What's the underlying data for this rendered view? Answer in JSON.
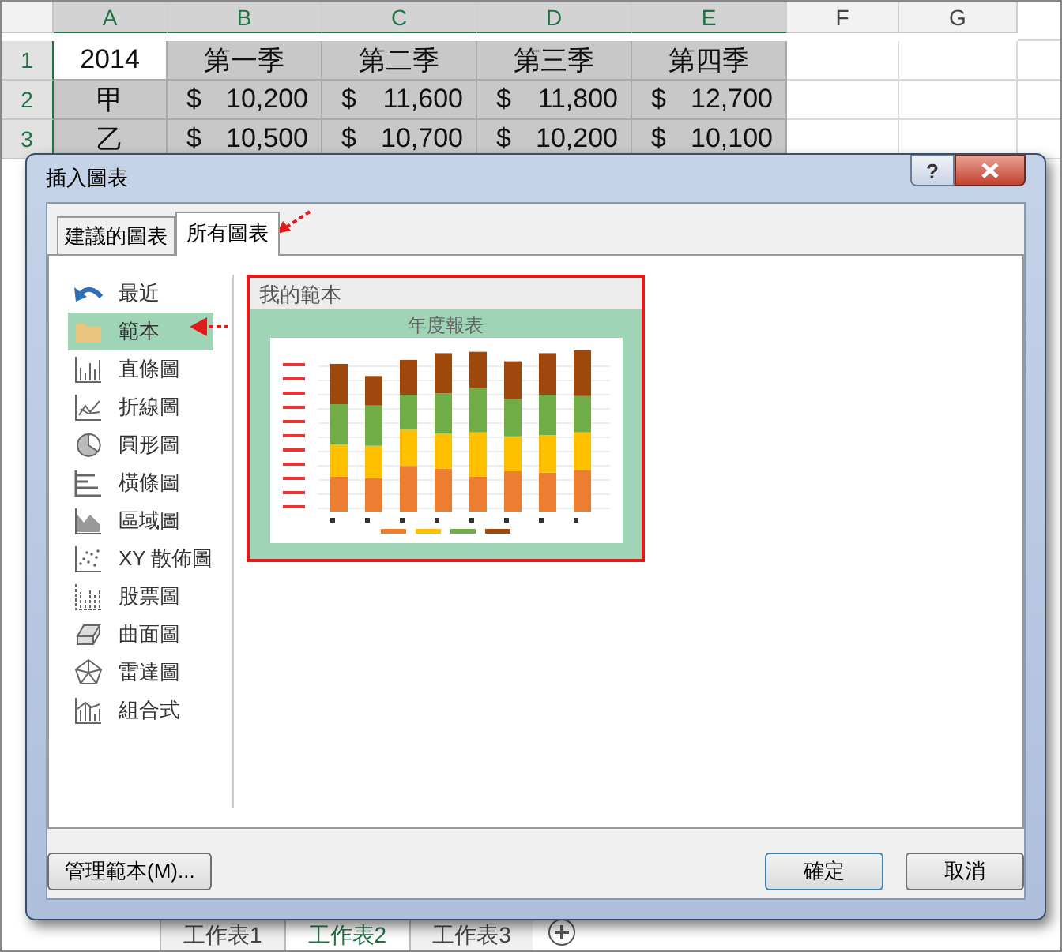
{
  "sheet": {
    "columns": [
      {
        "label": "A",
        "selected": true
      },
      {
        "label": "B",
        "selected": true
      },
      {
        "label": "C",
        "selected": true
      },
      {
        "label": "D",
        "selected": true
      },
      {
        "label": "E",
        "selected": true
      },
      {
        "label": "F",
        "selected": false
      },
      {
        "label": "G",
        "selected": false
      }
    ],
    "rows": [
      {
        "header": "1",
        "cells": [
          {
            "text": "2014"
          },
          {
            "text": "第一季"
          },
          {
            "text": "第二季"
          },
          {
            "text": "第三季"
          },
          {
            "text": "第四季"
          }
        ]
      },
      {
        "header": "2",
        "cells": [
          {
            "text": "甲"
          },
          {
            "currency": "$",
            "amount": "10,200"
          },
          {
            "currency": "$",
            "amount": "11,600"
          },
          {
            "currency": "$",
            "amount": "11,800"
          },
          {
            "currency": "$",
            "amount": "12,700"
          }
        ]
      },
      {
        "header": "3",
        "cells": [
          {
            "text": "乙"
          },
          {
            "currency": "$",
            "amount": "10,500"
          },
          {
            "currency": "$",
            "amount": "10,700"
          },
          {
            "currency": "$",
            "amount": "10,200"
          },
          {
            "currency": "$",
            "amount": "10,100"
          }
        ]
      }
    ],
    "sheet_tabs": [
      {
        "label": "工作表1",
        "selected": false
      },
      {
        "label": "工作表2",
        "selected": true
      },
      {
        "label": "工作表3",
        "selected": false
      }
    ]
  },
  "dialog": {
    "title": "插入圖表",
    "help": "?",
    "tabs": [
      {
        "label": "建議的圖表",
        "selected": false
      },
      {
        "label": "所有圖表",
        "selected": true
      }
    ],
    "chart_types": [
      {
        "label": "最近",
        "selected": false
      },
      {
        "label": "範本",
        "selected": true
      },
      {
        "label": "直條圖",
        "selected": false
      },
      {
        "label": "折線圖",
        "selected": false
      },
      {
        "label": "圓形圖",
        "selected": false
      },
      {
        "label": "橫條圖",
        "selected": false
      },
      {
        "label": "區域圖",
        "selected": false
      },
      {
        "label": "XY 散佈圖",
        "selected": false
      },
      {
        "label": "股票圖",
        "selected": false
      },
      {
        "label": "曲面圖",
        "selected": false
      },
      {
        "label": "雷達圖",
        "selected": false
      },
      {
        "label": "組合式",
        "selected": false
      }
    ],
    "template": {
      "heading": "我的範本",
      "chart_title": "年度報表"
    },
    "manage_button": "管理範本(M)...",
    "buttons": [
      {
        "label": "確定",
        "selected": true
      },
      {
        "label": "取消",
        "selected": false
      }
    ]
  }
}
